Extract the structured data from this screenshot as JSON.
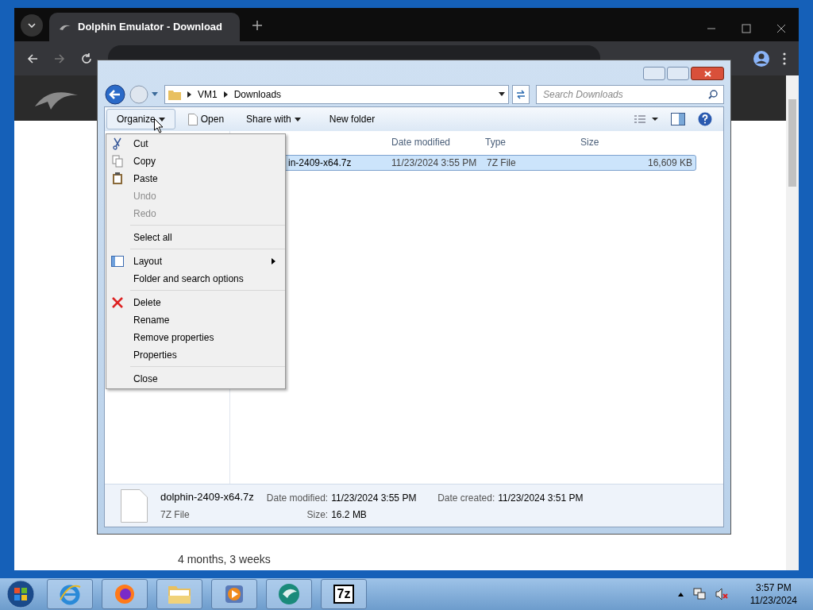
{
  "browser": {
    "tab": {
      "title": "Dolphin Emulator - Download"
    },
    "page_text": "4 months, 3 weeks"
  },
  "explorer": {
    "breadcrumb": [
      "VM1",
      "Downloads"
    ],
    "search": {
      "placeholder": "Search Downloads"
    },
    "toolbar": [
      {
        "label": "Organize",
        "kind": "dropdown"
      },
      {
        "label": "Open",
        "kind": "open"
      },
      {
        "label": "Share with",
        "kind": "dropdown"
      },
      {
        "label": "New folder",
        "kind": "plain"
      }
    ],
    "columns": [
      "Date modified",
      "Type",
      "Size"
    ],
    "files": [
      {
        "name": "in-2409-x64.7z",
        "date": "11/23/2024 3:55 PM",
        "type": "7Z File",
        "size": "16,609 KB",
        "selected": true
      }
    ],
    "menu": [
      {
        "items": [
          {
            "label": "Cut",
            "kind": "cut",
            "disabled": false,
            "submenu": false
          },
          {
            "label": "Copy",
            "kind": "copy",
            "disabled": false,
            "submenu": false
          },
          {
            "label": "Paste",
            "kind": "paste",
            "disabled": false,
            "submenu": false
          },
          {
            "label": "Undo",
            "kind": "plain",
            "disabled": true,
            "submenu": false
          },
          {
            "label": "Redo",
            "kind": "plain",
            "disabled": true,
            "submenu": false
          }
        ]
      },
      {
        "items": [
          {
            "label": "Select all",
            "kind": "plain",
            "disabled": false,
            "submenu": false
          }
        ]
      },
      {
        "items": [
          {
            "label": "Layout",
            "kind": "layout",
            "disabled": false,
            "submenu": true
          },
          {
            "label": "Folder and search options",
            "kind": "plain",
            "disabled": false,
            "submenu": false
          }
        ]
      },
      {
        "items": [
          {
            "label": "Delete",
            "kind": "delete",
            "disabled": false,
            "submenu": false
          },
          {
            "label": "Rename",
            "kind": "plain",
            "disabled": false,
            "submenu": false
          },
          {
            "label": "Remove properties",
            "kind": "plain",
            "disabled": false,
            "submenu": false
          },
          {
            "label": "Properties",
            "kind": "plain",
            "disabled": false,
            "submenu": false
          }
        ]
      },
      {
        "items": [
          {
            "label": "Close",
            "kind": "plain",
            "disabled": false,
            "submenu": false
          }
        ]
      }
    ],
    "details": {
      "name": "dolphin-2409-x64.7z",
      "type": "7Z File",
      "fields": [
        {
          "label": "Date modified:",
          "value": "11/23/2024 3:55 PM"
        },
        {
          "label": "Size:",
          "value": "16.2 MB"
        },
        {
          "label": "Date created:",
          "value": "11/23/2024 3:51 PM"
        }
      ]
    }
  },
  "taskbar": {
    "apps": [
      {
        "kind": "ie"
      },
      {
        "kind": "firefox"
      },
      {
        "kind": "explorer"
      },
      {
        "kind": "media"
      },
      {
        "kind": "dolphin"
      },
      {
        "kind": "sevenzip",
        "label": "7z"
      }
    ],
    "clock": {
      "time": "3:57 PM",
      "date": "11/23/2024"
    }
  }
}
